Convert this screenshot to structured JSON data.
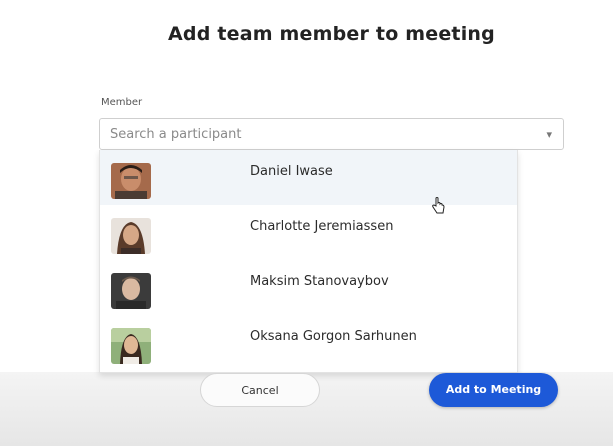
{
  "dialog": {
    "title": "Add team member to meeting",
    "member_label": "Member",
    "search_placeholder": "Search a participant",
    "participants": [
      {
        "name": "Daniel Iwase",
        "avatar": "avatar-man-dark-hair"
      },
      {
        "name": "Charlotte Jeremiassen",
        "avatar": "avatar-woman-long-hair"
      },
      {
        "name": "Maksim Stanovaybov",
        "avatar": "avatar-man-short-hair"
      },
      {
        "name": "Oksana Gorgon Sarhunen",
        "avatar": "avatar-woman-outdoor"
      }
    ],
    "cancel_label": "Cancel",
    "add_label": "Add to Meeting"
  },
  "colors": {
    "primary": "#1d59d8",
    "hover_row": "#f1f5f9"
  }
}
